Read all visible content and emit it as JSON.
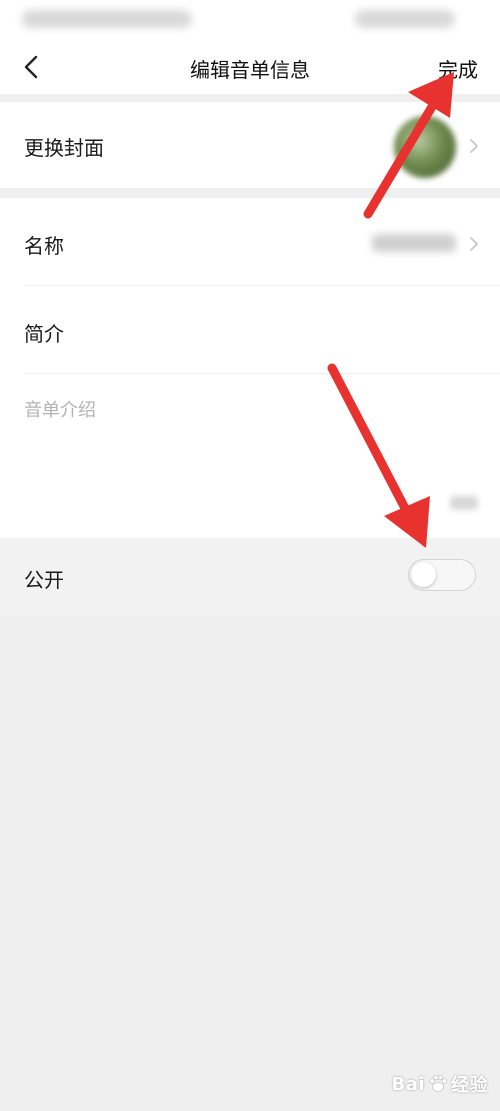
{
  "header": {
    "title": "编辑音单信息",
    "done_label": "完成"
  },
  "rows": {
    "cover_label": "更换封面",
    "name_label": "名称",
    "intro_label": "简介",
    "intro_placeholder": "音单介绍",
    "public_label": "公开"
  },
  "toggle": {
    "public_on": false
  },
  "icons": {
    "back": "chevron-left-icon",
    "row_chevron": "chevron-right-icon",
    "watermark_paw": "paw-icon"
  },
  "watermark": {
    "left": "Bai",
    "right": "经验"
  },
  "colors": {
    "annotation_arrow": "#e8322f",
    "background": "#efefef",
    "surface": "#ffffff"
  }
}
